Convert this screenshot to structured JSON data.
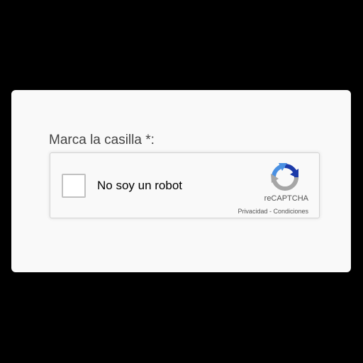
{
  "form": {
    "field_label": "Marca la casilla *:"
  },
  "captcha": {
    "label": "No soy un robot",
    "brand": "reCAPTCHA",
    "privacy_link": "Privacidad",
    "separator": " - ",
    "terms_link": "Condiciones",
    "logo_icon": "recaptcha-logo-icon",
    "colors": {
      "logo_blue": "#1c3aa9",
      "logo_light_blue": "#4a90e2",
      "logo_gray": "#a6a6a6",
      "checkbox_border": "#c1c1c1"
    }
  }
}
